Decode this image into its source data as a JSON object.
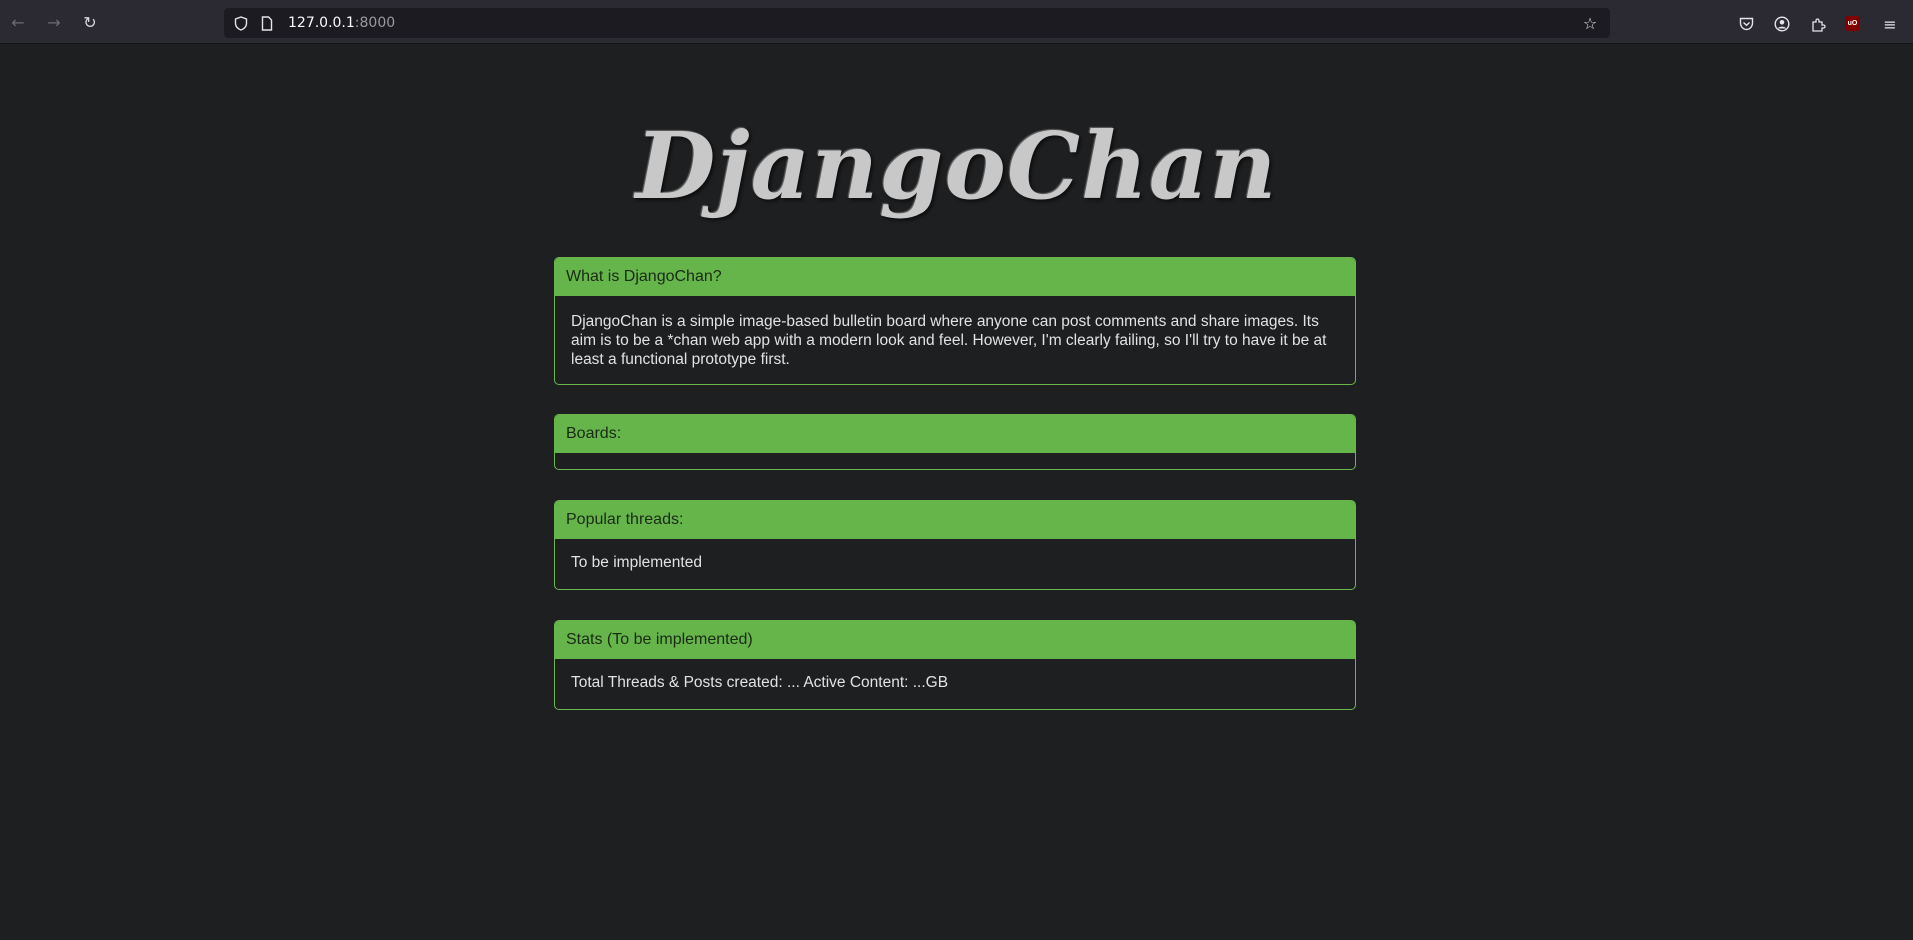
{
  "browser": {
    "url_host": "127.0.0.1",
    "url_port": ":8000",
    "icons": {
      "back": "arrow-left-icon",
      "forward": "arrow-right-icon",
      "reload": "reload-icon",
      "tracking_protection": "shield-icon",
      "page_info": "page-icon",
      "bookmark": "star-icon",
      "pocket": "pocket-icon",
      "account": "account-icon",
      "extensions": "puzzle-icon",
      "ublock": "ublock-icon",
      "menu": "hamburger-menu-icon"
    },
    "ublock_label": "uO"
  },
  "page": {
    "logo": "DjangoChan",
    "colors": {
      "background": "#1e1f21",
      "panel_header": "#66b54b",
      "panel_border": "#6ab64a",
      "logo": "#c8c8c8"
    },
    "panels": [
      {
        "title": "What is DjangoChan?",
        "body": "DjangoChan is a simple image-based bulletin board where anyone can post comments and share images. Its aim is to be a *chan web app with a modern look and feel. However, I'm clearly failing, so I'll try to have it be at least a functional prototype first."
      },
      {
        "title": "Boards:",
        "body": ""
      },
      {
        "title": "Popular threads:",
        "body": "To be implemented"
      },
      {
        "title": "Stats (To be implemented)",
        "body": "Total Threads & Posts created: ... Active Content: ...GB"
      }
    ]
  }
}
